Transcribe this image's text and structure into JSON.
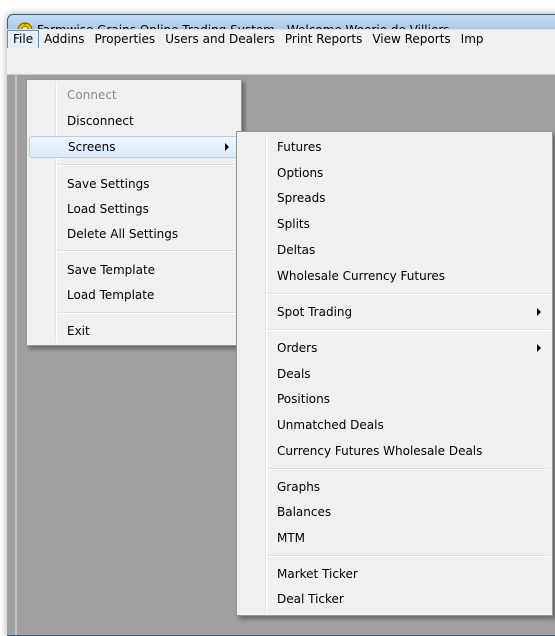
{
  "window": {
    "title": "Farmwise Grains Online Trading System - Welcome Woerie de Villiers"
  },
  "menubar": {
    "items": [
      {
        "label": "File",
        "open": true
      },
      {
        "label": "Addins"
      },
      {
        "label": "Properties"
      },
      {
        "label": "Users and Dealers"
      },
      {
        "label": "Print Reports"
      },
      {
        "label": "View Reports"
      },
      {
        "label": "Imp"
      }
    ]
  },
  "file_menu": {
    "items": [
      {
        "label": "Connect",
        "disabled": true
      },
      {
        "label": "Disconnect"
      },
      {
        "label": "Screens",
        "active": true,
        "has_submenu": true
      },
      {
        "label": "Save Settings"
      },
      {
        "label": "Load Settings"
      },
      {
        "label": "Delete All Settings"
      },
      {
        "label": "Save Template"
      },
      {
        "label": "Load Template"
      },
      {
        "label": "Exit"
      }
    ]
  },
  "screens_submenu": {
    "items": [
      {
        "label": "Futures"
      },
      {
        "label": "Options"
      },
      {
        "label": "Spreads"
      },
      {
        "label": "Splits"
      },
      {
        "label": "Deltas"
      },
      {
        "label": "Wholesale Currency Futures"
      },
      {
        "label": "Spot Trading",
        "has_submenu": true
      },
      {
        "label": "Orders",
        "has_submenu": true
      },
      {
        "label": "Deals"
      },
      {
        "label": "Positions"
      },
      {
        "label": "Unmatched Deals"
      },
      {
        "label": "Currency Futures Wholesale Deals"
      },
      {
        "label": "Graphs"
      },
      {
        "label": "Balances"
      },
      {
        "label": "MTM"
      },
      {
        "label": "Market Ticker"
      },
      {
        "label": "Deal Ticker"
      }
    ]
  },
  "icons": {
    "app": "sun-gear-icon",
    "submenu_arrow": "chevron-right-icon"
  },
  "colors": {
    "title_gradient_top": "#c7def3",
    "menu_bg": "#f0f0f0",
    "client_bg": "#a0a0a0",
    "highlight_border": "#aecff7"
  }
}
